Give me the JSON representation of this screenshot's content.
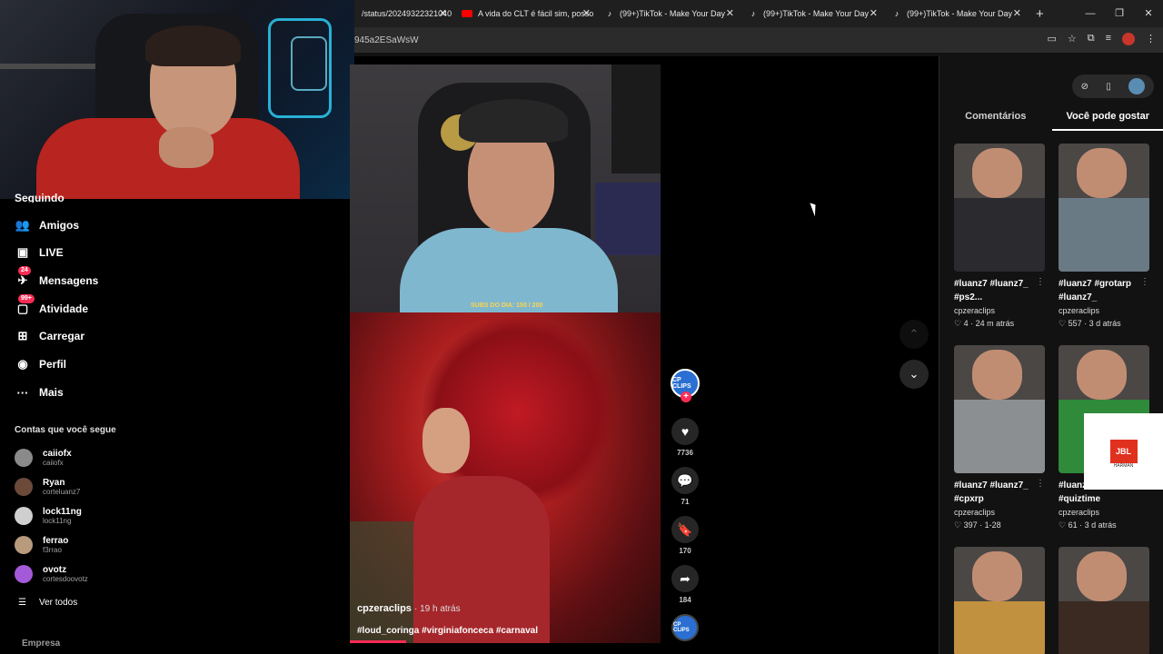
{
  "browser": {
    "tabs": [
      {
        "title": "/status/20249322321040",
        "favicon": "x"
      },
      {
        "title": "A vida do CLT é fácil sim, posso",
        "favicon": "youtube"
      },
      {
        "title": "(99+)TikTok - Make Your Day",
        "favicon": "tiktok"
      },
      {
        "title": "(99+)TikTok - Make Your Day",
        "favicon": "tiktok"
      },
      {
        "title": "(99+)TikTok - Make Your Day",
        "favicon": "tiktok"
      }
    ],
    "url": "945a2ESaWsW"
  },
  "sidebar": {
    "cut_item": "Seguindo",
    "items": [
      {
        "label": "Amigos",
        "icon": "friends-icon"
      },
      {
        "label": "LIVE",
        "icon": "live-icon"
      },
      {
        "label": "Mensagens",
        "icon": "messages-icon",
        "badge": "24"
      },
      {
        "label": "Atividade",
        "icon": "activity-icon",
        "badge": "99+"
      },
      {
        "label": "Carregar",
        "icon": "upload-icon"
      },
      {
        "label": "Perfil",
        "icon": "profile-icon"
      },
      {
        "label": "Mais",
        "icon": "more-icon"
      }
    ],
    "following_title": "Contas que você segue",
    "accounts": [
      {
        "name": "caiiofx",
        "handle": "caiiofx",
        "color": "#8a8a8a"
      },
      {
        "name": "Ryan",
        "handle": "corteluanz7",
        "color": "#6b4a3a"
      },
      {
        "name": "lock11ng",
        "handle": "lock11ng",
        "color": "#cfcfcf"
      },
      {
        "name": "ferrao",
        "handle": "f3rrao",
        "color": "#b89a7d"
      },
      {
        "name": "ovotz",
        "handle": "cortesdoovotz",
        "color": "#a45ad8"
      }
    ],
    "see_all": "Ver todos",
    "footer": "Empresa"
  },
  "video": {
    "subtag": "SUBS DO DIA: 150 / 200",
    "author": "cpzeraclips",
    "time": "· 19 h atrás",
    "tags": "#loud_coringa #virginiafonceca #carnaval",
    "progress": 0.18
  },
  "actions": {
    "avatar_text": "CP CLIPS",
    "likes": "7736",
    "comments": "71",
    "saves": "170",
    "shares": "184"
  },
  "right_panel": {
    "tabs": [
      "Comentários",
      "Você pode gostar"
    ],
    "active_tab": 1,
    "cards": [
      {
        "caption": "#luanz7 #luanz7_ #ps2...",
        "author": "cpzeraclips",
        "likes": "4",
        "time": "24 m atrás"
      },
      {
        "caption": "#luanz7 #grotarp #luanz7_",
        "author": "cpzeraclips",
        "likes": "557",
        "time": "3 d atrás"
      },
      {
        "caption": "#luanz7 #luanz7_ #cpxrp",
        "author": "cpzeraclips",
        "likes": "397",
        "time": "1-28"
      },
      {
        "caption": "#luanz7 #quiz #quiztime",
        "author": "cpzeraclips",
        "likes": "61",
        "time": "3 d atrás"
      }
    ]
  },
  "ad": {
    "logo": "JBL",
    "sub": "HARMAN"
  },
  "colors": {
    "accent": "#fe2c55",
    "panel": "#121212",
    "bg": "#000000"
  }
}
